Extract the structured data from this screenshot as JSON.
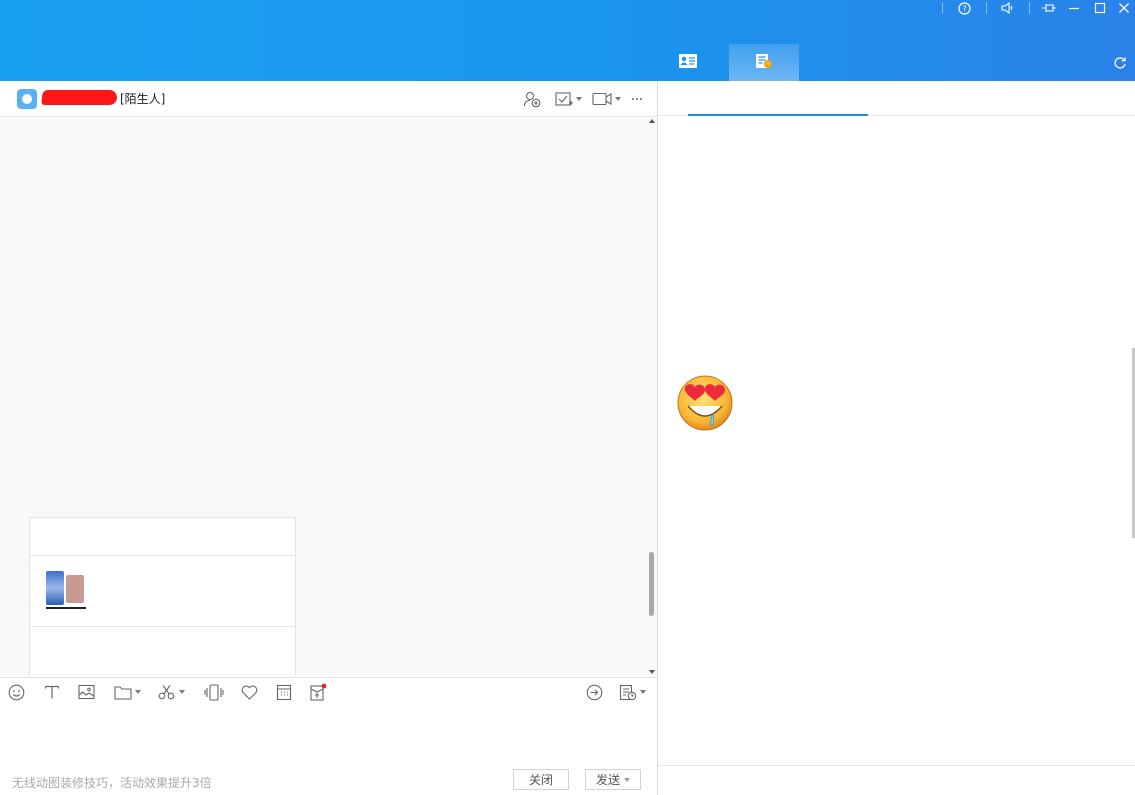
{
  "window": {
    "controls": [
      "help-icon",
      "volume-icon",
      "pin-icon",
      "minimize-icon",
      "maximize-icon",
      "close-icon"
    ]
  },
  "right_tabs": [
    {
      "icon": "contact-card-icon",
      "active": false
    },
    {
      "icon": "chat-history-icon",
      "active": true
    }
  ],
  "chat": {
    "contact_tag": "[陌生人]",
    "header_icons": [
      "add-friend-icon",
      "task-icon",
      "video-call-icon",
      "more-icon"
    ]
  },
  "toolbar": {
    "icons": [
      "emoji-icon",
      "font-icon",
      "image-icon",
      "folder-icon",
      "screenshot-icon",
      "shake-icon",
      "favorite-icon",
      "calendar-icon",
      "red-packet-icon",
      "quick-reply-icon",
      "history-icon"
    ]
  },
  "footer": {
    "hint": "无线动图装修技巧，活动效果提升3倍",
    "close_label": "关闭",
    "send_label": "发送"
  },
  "colors": {
    "topbar": "#1b95ee",
    "accent_line": "#1a92d8",
    "redaction": "#ff1616"
  }
}
